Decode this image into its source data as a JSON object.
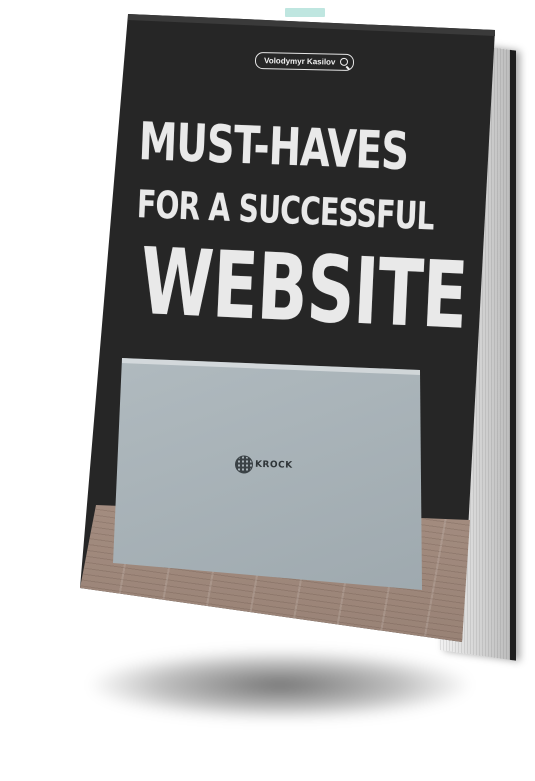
{
  "book": {
    "author": "Volodymyr Kasilov",
    "title_line_1": "MUST-HAVES",
    "title_line_2": "FOR A SUCCESSFUL",
    "title_line_3": "WEBSITE",
    "laptop_brand": "KROCK"
  },
  "colors": {
    "cover": "#262626",
    "title_text": "#e9e9e9",
    "bookmark": "#bfe6e0",
    "laptop": "#aeb8bd",
    "wood": "#a99285"
  },
  "icons": {
    "author_badge_icon": "search-icon",
    "laptop_logo_icon": "globe-logo-icon"
  }
}
